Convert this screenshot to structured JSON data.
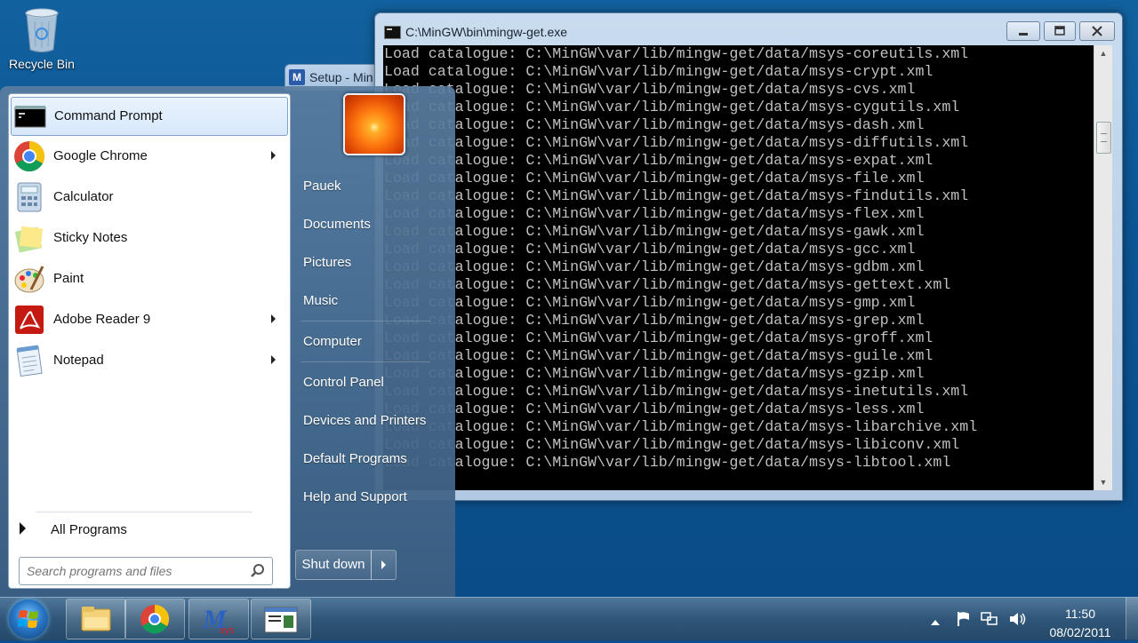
{
  "desktop": {
    "recycle_bin_label": "Recycle Bin"
  },
  "setup_window": {
    "title": "Setup - Min"
  },
  "console": {
    "title": "C:\\MinGW\\bin\\mingw-get.exe",
    "lines": [
      "Load catalogue: C:\\MinGW\\var/lib/mingw-get/data/msys-coreutils.xml",
      "Load catalogue: C:\\MinGW\\var/lib/mingw-get/data/msys-crypt.xml",
      "Load catalogue: C:\\MinGW\\var/lib/mingw-get/data/msys-cvs.xml",
      "Load catalogue: C:\\MinGW\\var/lib/mingw-get/data/msys-cygutils.xml",
      "Load catalogue: C:\\MinGW\\var/lib/mingw-get/data/msys-dash.xml",
      "Load catalogue: C:\\MinGW\\var/lib/mingw-get/data/msys-diffutils.xml",
      "Load catalogue: C:\\MinGW\\var/lib/mingw-get/data/msys-expat.xml",
      "Load catalogue: C:\\MinGW\\var/lib/mingw-get/data/msys-file.xml",
      "Load catalogue: C:\\MinGW\\var/lib/mingw-get/data/msys-findutils.xml",
      "Load catalogue: C:\\MinGW\\var/lib/mingw-get/data/msys-flex.xml",
      "Load catalogue: C:\\MinGW\\var/lib/mingw-get/data/msys-gawk.xml",
      "Load catalogue: C:\\MinGW\\var/lib/mingw-get/data/msys-gcc.xml",
      "Load catalogue: C:\\MinGW\\var/lib/mingw-get/data/msys-gdbm.xml",
      "Load catalogue: C:\\MinGW\\var/lib/mingw-get/data/msys-gettext.xml",
      "Load catalogue: C:\\MinGW\\var/lib/mingw-get/data/msys-gmp.xml",
      "Load catalogue: C:\\MinGW\\var/lib/mingw-get/data/msys-grep.xml",
      "Load catalogue: C:\\MinGW\\var/lib/mingw-get/data/msys-groff.xml",
      "Load catalogue: C:\\MinGW\\var/lib/mingw-get/data/msys-guile.xml",
      "Load catalogue: C:\\MinGW\\var/lib/mingw-get/data/msys-gzip.xml",
      "Load catalogue: C:\\MinGW\\var/lib/mingw-get/data/msys-inetutils.xml",
      "Load catalogue: C:\\MinGW\\var/lib/mingw-get/data/msys-less.xml",
      "Load catalogue: C:\\MinGW\\var/lib/mingw-get/data/msys-libarchive.xml",
      "Load catalogue: C:\\MinGW\\var/lib/mingw-get/data/msys-libiconv.xml",
      "Load catalogue: C:\\MinGW\\var/lib/mingw-get/data/msys-libtool.xml"
    ]
  },
  "start_menu": {
    "programs": [
      {
        "label": "Command Prompt",
        "icon": "cmd-icon",
        "selected": true,
        "submenu": false
      },
      {
        "label": "Google Chrome",
        "icon": "chrome-icon",
        "selected": false,
        "submenu": true
      },
      {
        "label": "Calculator",
        "icon": "calculator-icon",
        "selected": false,
        "submenu": false
      },
      {
        "label": "Sticky Notes",
        "icon": "sticky-notes-icon",
        "selected": false,
        "submenu": false
      },
      {
        "label": "Paint",
        "icon": "paint-icon",
        "selected": false,
        "submenu": false
      },
      {
        "label": "Adobe Reader 9",
        "icon": "adobe-reader-icon",
        "selected": false,
        "submenu": true
      },
      {
        "label": "Notepad",
        "icon": "notepad-icon",
        "selected": false,
        "submenu": true
      }
    ],
    "all_programs": "All Programs",
    "search_placeholder": "Search programs and files",
    "right_items": [
      "Pauek",
      "Documents",
      "Pictures",
      "Music",
      "Computer",
      "Control Panel",
      "Devices and Printers",
      "Default Programs",
      "Help and Support"
    ],
    "shutdown_label": "Shut down"
  },
  "taskbar": {
    "time": "11:50",
    "date": "08/02/2011",
    "pinned": [
      "explorer-icon",
      "chrome-icon",
      "msys-icon",
      "console-window-icon"
    ]
  }
}
